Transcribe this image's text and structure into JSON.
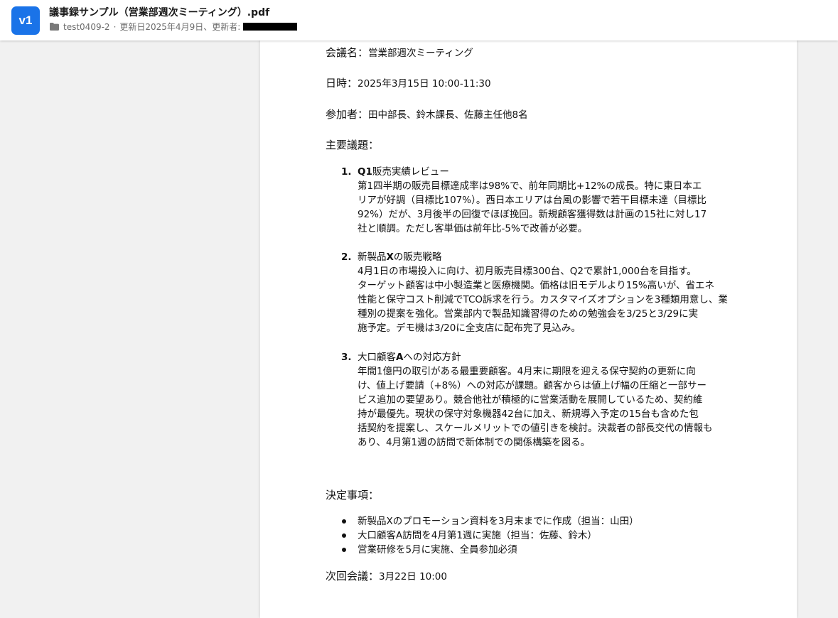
{
  "header": {
    "version_badge": "v1",
    "title": "議事録サンプル（営業部週次ミーティング）.pdf",
    "folder_name": "test0409-2",
    "separator": "·",
    "updated_text": "更新日2025年4月9日、更新者:",
    "updater_redacted": true
  },
  "document": {
    "meeting_name": {
      "label": "会議名：",
      "value": "営業部週次ミーティング"
    },
    "datetime": {
      "label": "日時：",
      "value": "2025年3月15日 10:00-11:30"
    },
    "attendees": {
      "label": "参加者：",
      "value": "田中部長、鈴木課長、佐藤主任他8名"
    },
    "agenda_heading": "主要議題：",
    "topics": [
      {
        "number": "1.",
        "title_bold": "Q1",
        "title_rest": "販売実績レビュー",
        "lines": [
          "第1四半期の販売目標達成率は98%で、前年同期比+12%の成長。特に東日本エ",
          "リアが好調（目標比107%）。西日本エリアは台風の影響で若干目標未達（目標比",
          "92%）だが、3月後半の回復でほぼ挽回。新規顧客獲得数は計画の15社に対し17",
          "社と順調。ただし客単価は前年比-5%で改善が必要。"
        ]
      },
      {
        "number": "2.",
        "title_pre": "新製品",
        "title_bold": "X",
        "title_rest": "の販売戦略",
        "lines": [
          "4月1日の市場投入に向け、初月販売目標300台、Q2で累計1,000台を目指す。",
          "ターゲット顧客は中小製造業と医療機関。価格は旧モデルより15%高いが、省エネ",
          "性能と保守コスト削減でTCO訴求を行う。カスタマイズオプションを3種類用意し、業",
          "種別の提案を強化。営業部内で製品知識習得のための勉強会を3/25と3/29に実",
          "施予定。デモ機は3/20に全支店に配布完了見込み。"
        ]
      },
      {
        "number": "3.",
        "title_pre": "大口顧客",
        "title_bold": "A",
        "title_rest": "への対応方針",
        "lines": [
          "年間1億円の取引がある最重要顧客。4月末に期限を迎える保守契約の更新に向",
          "け、値上げ要請（+8%）への対応が課題。顧客からは値上げ幅の圧縮と一部サー",
          "ビス追加の要望あり。競合他社が積極的に営業活動を展開しているため、契約維",
          "持が最優先。現状の保守対象機器42台に加え、新規導入予定の15台も含めた包",
          "括契約を提案し、スケールメリットでの値引きを検討。決裁者の部長交代の情報も",
          "あり、4月第1週の訪問で新体制での関係構築を図る。"
        ]
      }
    ],
    "decisions_heading": "決定事項：",
    "decisions": [
      "新製品Xのプロモーション資料を3月末までに作成（担当：山田）",
      "大口顧客A訪問を4月第1週に実施（担当：佐藤、鈴木）",
      "営業研修を5月に実施、全員参加必須"
    ],
    "next_meeting": {
      "label": "次回会議：",
      "value": "3月22日 10:00"
    }
  },
  "colors": {
    "badge": "#1a73e8",
    "background": "#f1f1f1",
    "page": "#ffffff",
    "meta_text": "#6b6b6b"
  }
}
